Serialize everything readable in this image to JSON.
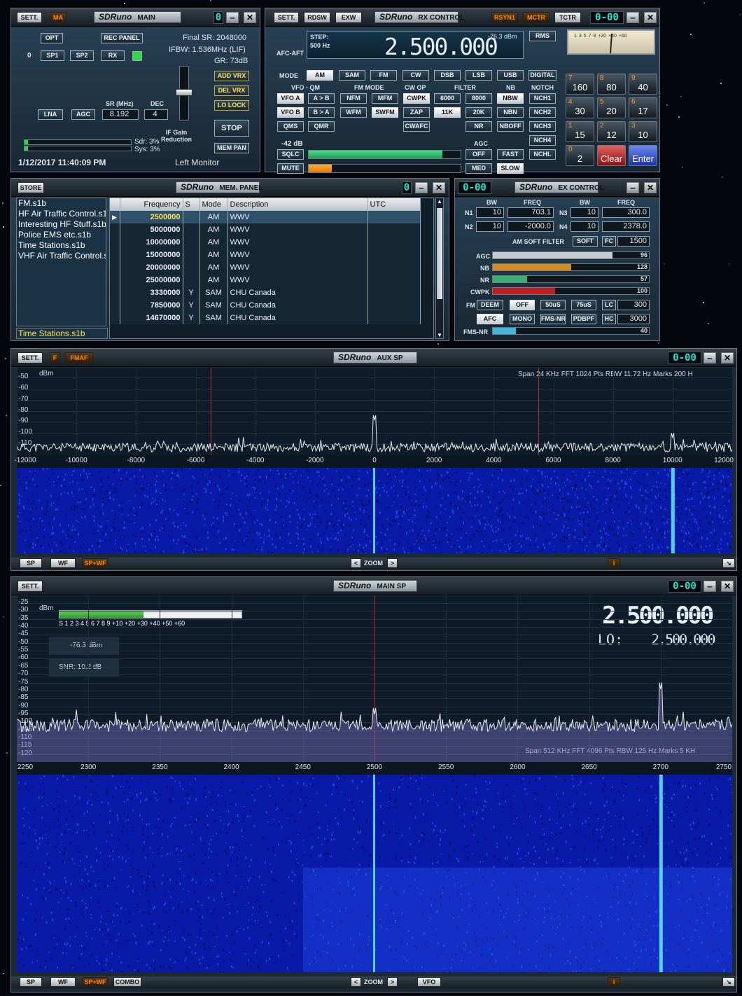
{
  "main": {
    "title": "SDRuno",
    "subtitle": "MAIN",
    "sett": "SETT.",
    "ma": "MA",
    "seg": "0",
    "opt": "OPT",
    "rec": "REC PANEL",
    "zero": "0",
    "sp1": "SP1",
    "sp2": "SP2",
    "rx": "RX",
    "final_sr": "Final SR: 2048000",
    "ifbw": "IFBW: 1.536MHz (LIF)",
    "gr": "GR: 73dB",
    "sr_lbl": "SR (MHz)",
    "dec_lbl": "DEC",
    "lna": "LNA",
    "agc": "AGC",
    "sr_val": "8.192",
    "dec_val": "4",
    "ifgain": "IF Gain\nReduction",
    "add_vrx": "ADD VRX",
    "del_vrx": "DEL VRX",
    "lo_lock": "LO LOCK",
    "stop": "STOP",
    "mem_pan": "MEM PAN",
    "sdr": "Sdr: 3%",
    "sys": "Sys: 3%",
    "datetime": "1/12/2017 11:40:09 PM",
    "monitor": "Left Monitor",
    "sdr_pct": 3,
    "sys_pct": 3
  },
  "rx": {
    "title": "SDRuno",
    "subtitle": "RX CONTROL",
    "sett": "SETT.",
    "rdsw": "RDSW",
    "exw": "EXW",
    "rsyn": "RSYN1",
    "mctr": "MCTR",
    "tctr": "TCTR",
    "seg": "0-00",
    "step_lbl": "STEP:",
    "step_val": "500 Hz",
    "afc": "AFC-AFT",
    "freq": "2.500.000",
    "dbm": "-76.3 dBm",
    "rms": "RMS",
    "mode": "MODE",
    "modes": [
      "AM",
      "SAM",
      "FM",
      "CW",
      "DSB",
      "LSB",
      "USB",
      "DIGITAL"
    ],
    "vfoqm": "VFO - QM",
    "fmmode": "FM MODE",
    "cwop": "CW OP",
    "filter": "FILTER",
    "nb": "NB",
    "notch": "NOTCH",
    "vfoa": "VFO A",
    "atob": "A > B",
    "nfm": "NFM",
    "mfm": "MFM",
    "cwpk": "CWPK",
    "f6000": "6000",
    "f8000": "8000",
    "nbw": "NBW",
    "nch1": "NCH1",
    "vfob": "VFO B",
    "btoa": "B > A",
    "wfm": "WFM",
    "swfm": "SWFM",
    "zap": "ZAP",
    "f11k": "11K",
    "f20k": "20K",
    "nbn": "NBN",
    "nch2": "NCH2",
    "qms": "QMS",
    "qmr": "QMR",
    "cwafc": "CWAFC",
    "nr": "NR",
    "nboff": "NBOFF",
    "nch3": "NCH3",
    "nch4": "NCH4",
    "nchl": "NCHL",
    "sql_db": "-42 dB",
    "sqlc": "SQLC",
    "agc": "AGC",
    "off": "OFF",
    "fast": "FAST",
    "mute": "MUTE",
    "med": "MED",
    "slow": "SLOW",
    "sql_pct": 0.88,
    "vol_pct": 0.15,
    "keys": [
      {
        "k": "7",
        "v": "160"
      },
      {
        "k": "8",
        "v": "80"
      },
      {
        "k": "9",
        "v": "40"
      },
      {
        "k": "4",
        "v": "30"
      },
      {
        "k": "5",
        "v": "20"
      },
      {
        "k": "6",
        "v": "17"
      },
      {
        "k": "1",
        "v": "15"
      },
      {
        "k": "2",
        "v": "12"
      },
      {
        "k": "3",
        "v": "10"
      },
      {
        "k": "0",
        "v": "2"
      },
      {
        "k": "",
        "v": "Clear"
      },
      {
        "k": "",
        "v": "Enter"
      }
    ],
    "meter_scale": "1 3 5 7 9 +20 +40 +60"
  },
  "mem": {
    "store": "STORE",
    "title": "SDRuno",
    "subtitle": "MEM. PANEL",
    "seg": "0",
    "files": [
      "FM.s1b",
      "HF Air Traffic Control.s1b",
      "Interesting HF Stuff.s1b",
      "Police EMS etc.s1b",
      "Time Stations.s1b",
      "VHF Air Traffic Control.s1b"
    ],
    "current_file": "Time Stations.s1b",
    "headers": [
      "Frequency",
      "S",
      "Mode",
      "Description",
      "UTC"
    ],
    "rows": [
      [
        "2500000",
        "",
        "AM",
        "WWV",
        ""
      ],
      [
        "5000000",
        "",
        "AM",
        "WWV",
        ""
      ],
      [
        "10000000",
        "",
        "AM",
        "WWV",
        ""
      ],
      [
        "15000000",
        "",
        "AM",
        "WWV",
        ""
      ],
      [
        "20000000",
        "",
        "AM",
        "WWV",
        ""
      ],
      [
        "25000000",
        "",
        "AM",
        "WWV",
        ""
      ],
      [
        "3330000",
        "Y",
        "SAM",
        "CHU Canada",
        ""
      ],
      [
        "7850000",
        "Y",
        "SAM",
        "CHU Canada",
        ""
      ],
      [
        "14670000",
        "Y",
        "SAM",
        "CHU Canada",
        ""
      ]
    ]
  },
  "ex": {
    "title": "SDRuno",
    "subtitle": "EX CONTROL",
    "seg": "0-00",
    "bw": "BW",
    "freq": "FREQ",
    "n1": "N1",
    "n2": "N2",
    "n3": "N3",
    "n4": "N4",
    "n1bw": "10",
    "n1f": "703.1",
    "n2bw": "10",
    "n2f": "-2000.0",
    "n3bw": "10",
    "n3f": "300.0",
    "n4bw": "10",
    "n4f": "2378.0",
    "amsoft": "AM SOFT FILTER",
    "soft": "SOFT",
    "fc": "FC",
    "fcval": "1500",
    "agc": "AGC",
    "agcv": "96",
    "nb": "NB",
    "nbv": "128",
    "nr": "NR",
    "nrv": "57",
    "cwpk": "CWPK",
    "cwpkv": "100",
    "fm": "FM",
    "deem": "DEEM",
    "off": "OFF",
    "u50": "50uS",
    "u75": "75uS",
    "lc": "LC",
    "lcv": "300",
    "afc": "AFC",
    "mono": "MONO",
    "fmsnr": "FMS-NR",
    "pdbpf": "PDBPF",
    "hc": "HC",
    "hcv": "3000",
    "fmsnr2": "FMS-NR",
    "fmsnrv": "40",
    "agc_pct": 0.96,
    "nb_pct": 0.5,
    "nr_pct": 0.22,
    "cwpk_pct": 0.4,
    "fmsnr_pct": 0.15
  },
  "aux": {
    "sett": "SETT.",
    "f": "F",
    "fmaf": "FMAF",
    "title": "SDRuno",
    "subtitle": "AUX SP",
    "seg": "0-00",
    "dbm": "dBm",
    "info": "Span 24 KHz   FFT 1024 Pts   RBW 11.72 Hz   Marks 200 H",
    "sp": "SP",
    "wf": "WF",
    "spwf": "SP+WF",
    "zoom": "ZOOM",
    "i": "i"
  },
  "mainsp": {
    "sett": "SETT.",
    "title": "SDRuno",
    "subtitle": "MAIN SP",
    "seg": "0-00",
    "dbm": "dBm",
    "smeter_scale": "S  1  2  3  4  5  6  7  8  9  +10 +20 +30 +40 +50 +60",
    "level": "-76.3 dBm",
    "snr": "SNR: 10.2 dB",
    "freq": "2.500.000",
    "lo_lbl": "LO:",
    "lo": "2.500.000",
    "info": "Span 512 KHz   FFT 4096 Pts   RBW 125 Hz   Marks 5 KH",
    "sp": "SP",
    "wf": "WF",
    "spwf": "SP+WF",
    "combo": "COMBO",
    "zoom": "ZOOM",
    "vfo": "VFO",
    "i": "i",
    "smeter_pct": 0.46
  },
  "chart_data": [
    {
      "type": "line",
      "title": "AUX SP",
      "ylabel": "dBm",
      "ylim": [
        -120,
        -50
      ],
      "yticks": [
        -50,
        -60,
        -70,
        -80,
        -90,
        -100,
        -110
      ],
      "xlim": [
        -12000,
        12000
      ],
      "xticks": [
        "-12000",
        "-10000",
        "-8000",
        "-6000",
        "-4000",
        "-2000",
        "0",
        "2000",
        "4000",
        "6000",
        "8000",
        "10000",
        "12000"
      ],
      "noise_floor": -113,
      "peaks": [
        {
          "x": 0,
          "y": -88
        },
        {
          "x": 10000,
          "y": -104
        }
      ],
      "markers": [
        -5500,
        5500
      ]
    },
    {
      "type": "line",
      "title": "MAIN SP",
      "ylabel": "dBm",
      "ylim": [
        -125,
        -25
      ],
      "yticks": [
        -25,
        -30,
        -35,
        -40,
        -45,
        -50,
        -55,
        -60,
        -65,
        -70,
        -75,
        -80,
        -85,
        -90,
        -95,
        -100,
        -105,
        -110,
        -115,
        -120
      ],
      "xlim": [
        2250,
        2750
      ],
      "xticks": [
        "2250",
        "2300",
        "2350",
        "2400",
        "2450",
        "2500",
        "2550",
        "2600",
        "2650",
        "2700",
        "2750"
      ],
      "noise_floor": -102,
      "peaks": [
        {
          "x": 2500,
          "y": -95
        },
        {
          "x": 2700,
          "y": -79
        }
      ],
      "markers": [
        2500
      ]
    }
  ],
  "colors": {
    "accent_cyan": "#13e8ce",
    "orange": "#ff8a00",
    "waterfall": "#0a1aa8"
  }
}
